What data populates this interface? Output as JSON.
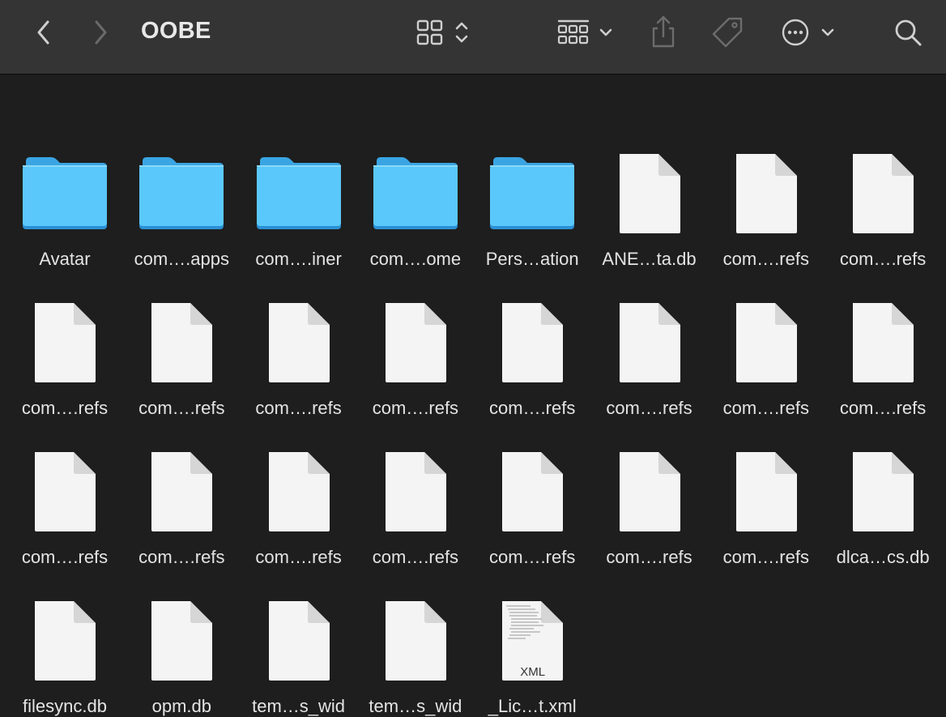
{
  "window": {
    "title": "OOBE"
  },
  "toolbar": {
    "back_icon": "chevron-left-icon",
    "forward_icon": "chevron-right-icon",
    "view_icon": "icon-grid-view-icon",
    "group_icon": "group-by-icon",
    "share_icon": "share-icon",
    "tag_icon": "tag-icon",
    "action_icon": "more-actions-icon",
    "search_icon": "search-icon"
  },
  "colors": {
    "folder_blue": "#5ac8fa",
    "file_white": "#f5f5f5",
    "background": "#1e1e1e",
    "toolbar": "#343434"
  },
  "items": [
    {
      "label": "Avatar",
      "kind": "folder"
    },
    {
      "label": "com….apps",
      "kind": "folder"
    },
    {
      "label": "com….iner",
      "kind": "folder"
    },
    {
      "label": "com….ome",
      "kind": "folder"
    },
    {
      "label": "Pers…ation",
      "kind": "folder"
    },
    {
      "label": "ANE…ta.db",
      "kind": "file"
    },
    {
      "label": "com….refs",
      "kind": "file"
    },
    {
      "label": "com….refs",
      "kind": "file"
    },
    {
      "label": "com….refs",
      "kind": "file"
    },
    {
      "label": "com….refs",
      "kind": "file"
    },
    {
      "label": "com….refs",
      "kind": "file"
    },
    {
      "label": "com….refs",
      "kind": "file"
    },
    {
      "label": "com….refs",
      "kind": "file"
    },
    {
      "label": "com….refs",
      "kind": "file"
    },
    {
      "label": "com….refs",
      "kind": "file"
    },
    {
      "label": "com….refs",
      "kind": "file"
    },
    {
      "label": "com….refs",
      "kind": "file"
    },
    {
      "label": "com….refs",
      "kind": "file"
    },
    {
      "label": "com….refs",
      "kind": "file"
    },
    {
      "label": "com….refs",
      "kind": "file"
    },
    {
      "label": "com….refs",
      "kind": "file"
    },
    {
      "label": "com….refs",
      "kind": "file"
    },
    {
      "label": "com….refs",
      "kind": "file"
    },
    {
      "label": "dlca…cs.db",
      "kind": "file"
    },
    {
      "label": "filesync.db",
      "kind": "file"
    },
    {
      "label": "opm.db",
      "kind": "file"
    },
    {
      "label": "tem…s_wid",
      "kind": "file"
    },
    {
      "label": "tem…s_wid",
      "kind": "file"
    },
    {
      "label": "_Lic…t.xml",
      "kind": "xml",
      "badge": "XML"
    }
  ]
}
